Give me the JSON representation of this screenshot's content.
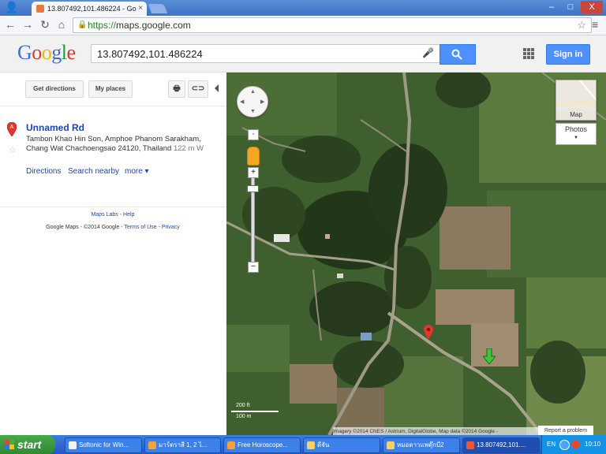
{
  "browser": {
    "tab_title": "13.807492,101.486224 - Go",
    "url_scheme": "https://",
    "url_host": "maps.google.com",
    "window_controls": [
      "–",
      "□",
      "X"
    ]
  },
  "google": {
    "logo": "Google",
    "search_value": "13.807492,101.486224",
    "signin_label": "Sign in",
    "colors": {
      "blue": "#4d90fe",
      "logo_g": "#3a6fe0",
      "logo_o1": "#d9372b",
      "logo_o2": "#f4b400",
      "logo_l": "#1c9b3c",
      "logo_e": "#d9372b"
    }
  },
  "panel": {
    "get_directions": "Get directions",
    "my_places": "My places",
    "place": {
      "pin_letter": "A",
      "name": "Unnamed Rd",
      "address_line1": "Tambon Khao Hin Son, Amphoe Phanom Sarakham,",
      "address_line2": "Chang Wat Chachoengsao 24120, Thailand",
      "distance": "122 m W"
    },
    "links": {
      "directions": "Directions",
      "search_nearby": "Search nearby",
      "more": "more ▾"
    },
    "footer": {
      "maps_labs": "Maps Labs",
      "help": "Help",
      "legal_prefix": "Google Maps - ©2014 Google -",
      "terms": "Terms of Use",
      "privacy": "Privacy"
    }
  },
  "map": {
    "map_type_label": "Map",
    "photos_label": "Photos",
    "scale_ft": "200 ft",
    "scale_m": "100 m",
    "attribution": "Imagery ©2014 CNES / Astrium, DigitalGlobe, Map data ©2014 Google -",
    "report": "Report a problem"
  },
  "taskbar": {
    "start": "start",
    "items": [
      {
        "label": "Softonic for Win...",
        "color": "#f2f2f2"
      },
      {
        "label": "มาร์ตราสี 1, 2 ไ...",
        "color": "#f4a13a"
      },
      {
        "label": "Free Horoscope...",
        "color": "#f4a13a"
      },
      {
        "label": "ดีจัน",
        "color": "#f6d168"
      },
      {
        "label": "หมอดาวแพตุ๊กบี2",
        "color": "#f6d168"
      },
      {
        "label": "13.807492,101....",
        "color": "#e35b3a"
      }
    ],
    "lang": "EN",
    "clock": "10:10"
  }
}
